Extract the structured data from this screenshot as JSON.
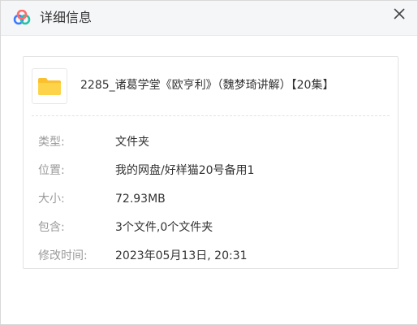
{
  "window": {
    "title": "详细信息",
    "logo_icon": "cloud-logo-icon",
    "close_icon": "close-icon"
  },
  "file": {
    "icon": "folder-icon",
    "name": "2285_诸葛学堂《欧亨利》（魏梦琦讲解）【20集】"
  },
  "details": [
    {
      "label": "类型:",
      "value": "文件夹"
    },
    {
      "label": "位置:",
      "value": "我的网盘/好样猫20号备用1"
    },
    {
      "label": "大小:",
      "value": "72.93MB"
    },
    {
      "label": "包含:",
      "value": "3个文件,0个文件夹"
    },
    {
      "label": "修改时间:",
      "value": "2023年05月13日, 20:31"
    }
  ],
  "colors": {
    "folder": "#fbc02d",
    "label": "#9a9a9a",
    "text": "#333333"
  }
}
